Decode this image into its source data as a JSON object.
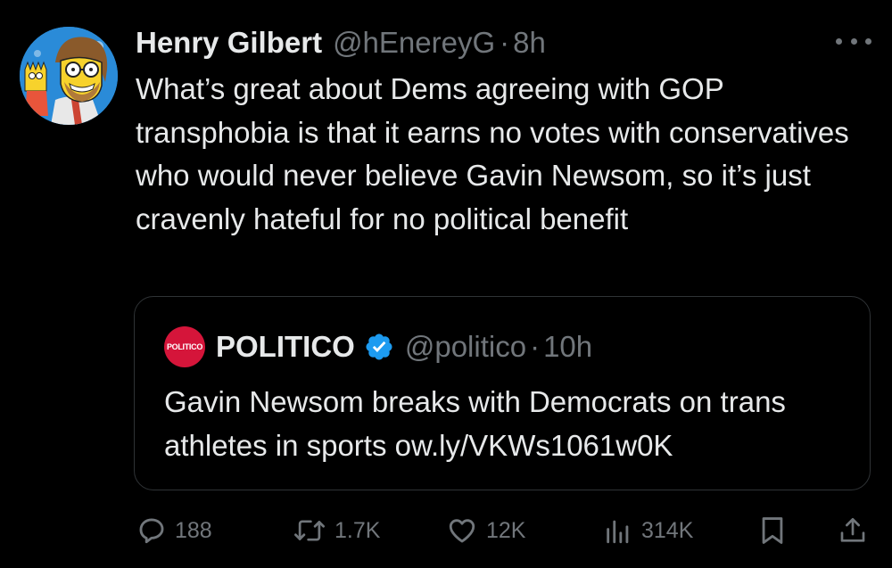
{
  "tweet": {
    "author_name": "Henry Gilbert",
    "author_handle": "@hEnereyG",
    "separator": "·",
    "time": "8h",
    "text": "What’s great about Dems agreeing with GOP transphobia is that it earns no votes with conservatives who would never believe Gavin Newsom, so it’s just cravenly hateful for no political benefit"
  },
  "quote": {
    "logo_text": "POLITICO",
    "author_name": "POLITICO",
    "verified": true,
    "author_handle": "@politico",
    "separator": "·",
    "time": "10h",
    "text": "Gavin Newsom breaks with Democrats on trans athletes in sports ow.ly/VKWs1061w0K"
  },
  "actions": {
    "replies": "188",
    "retweets": "1.7K",
    "likes": "12K",
    "views": "314K"
  },
  "icons": {
    "more": "more-horizontal-icon",
    "reply": "reply-icon",
    "retweet": "retweet-icon",
    "like": "heart-icon",
    "views": "views-icon",
    "bookmark": "bookmark-icon",
    "share": "share-icon",
    "verified": "verified-badge-icon"
  },
  "colors": {
    "background": "#000000",
    "text_primary": "#e7e9ea",
    "text_secondary": "#71767b",
    "border": "#2f3336",
    "verified": "#1d9bf0",
    "politico_red": "#d5153a"
  }
}
